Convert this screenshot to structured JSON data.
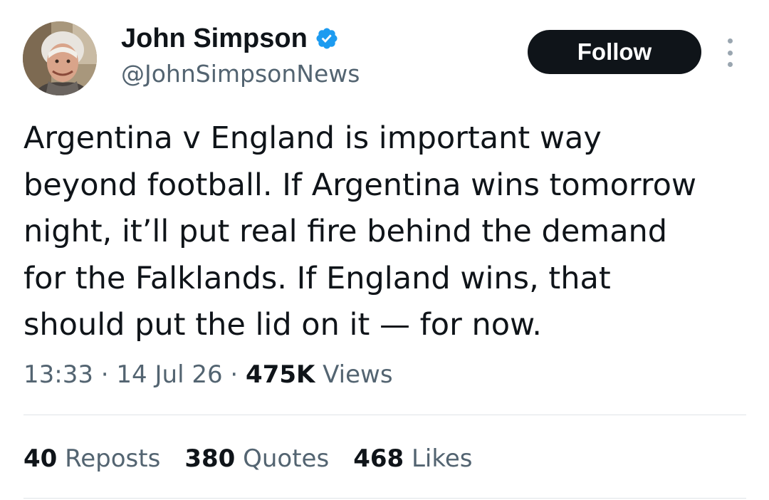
{
  "author": {
    "display_name": "John Simpson",
    "handle": "@JohnSimpsonNews",
    "verified_icon": "verified-badge-icon",
    "verified_color": "#1d9bf0"
  },
  "follow_button": {
    "label": "Follow"
  },
  "more_menu": {
    "icon": "more-options-icon"
  },
  "tweet": {
    "text_lines": [
      "Argentina v England is important way",
      "beyond football. If Argentina wins tomorrow",
      "night, it’ll put real fire behind the demand",
      "for the Falklands. If England wins, that",
      "should put the lid on it — for now."
    ]
  },
  "meta": {
    "time": "13:33",
    "separator": "·",
    "date": "14 Jul 26",
    "views_count": "475K",
    "views_label": "Views"
  },
  "stats": {
    "reposts_count": "40",
    "reposts_label": "Reposts",
    "quotes_count": "380",
    "quotes_label": "Quotes",
    "likes_count": "468",
    "likes_label": "Likes"
  },
  "colors": {
    "text_primary": "#0f1419",
    "text_secondary": "#536471",
    "button_bg": "#0f1419",
    "divider": "#dfe4e8"
  }
}
